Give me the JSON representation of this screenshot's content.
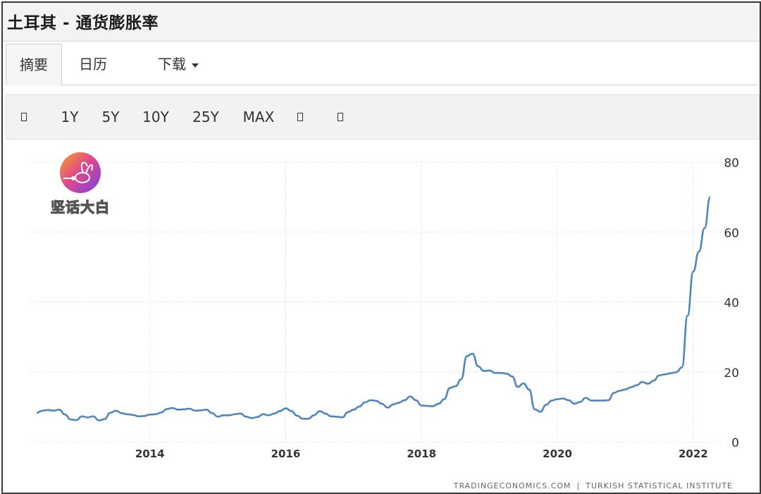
{
  "header": {
    "title": "土耳其 - 通货膨胀率"
  },
  "tabs": [
    {
      "label": "摘要"
    },
    {
      "label": "日历"
    },
    {
      "label": "下载"
    }
  ],
  "range_buttons": [
    "1Y",
    "5Y",
    "10Y",
    "25Y",
    "MAX"
  ],
  "range_icons": [
    "calendar-icon",
    "chart-type-icon",
    "settings-icon",
    "glyph-icon"
  ],
  "logo": {
    "text": "坚话大白"
  },
  "source": {
    "left": "TRADINGECONOMICS.COM",
    "separator": "|",
    "right": "TURKISH STATISTICAL INSTITUTE"
  },
  "colors": {
    "line": "#4f86bd",
    "grid": "#d8d8d8"
  },
  "chart_data": {
    "type": "line",
    "title": "",
    "xlabel": "",
    "ylabel": "",
    "x_ticks": [
      "2014",
      "2016",
      "2018",
      "2020",
      "2022"
    ],
    "y_ticks": [
      0,
      20,
      40,
      60,
      80
    ],
    "ylim": [
      0,
      80
    ],
    "xlim": [
      "2012-04",
      "2022-06"
    ],
    "y_axis_side": "right",
    "grid": true,
    "legend": "none",
    "series": [
      {
        "name": "",
        "points": [
          [
            "2012-05",
            8.3
          ],
          [
            "2012-06",
            8.9
          ],
          [
            "2012-07",
            9.1
          ],
          [
            "2012-08",
            8.9
          ],
          [
            "2012-09",
            9.2
          ],
          [
            "2012-10",
            7.8
          ],
          [
            "2012-11",
            6.4
          ],
          [
            "2012-12",
            6.2
          ],
          [
            "2013-01",
            7.3
          ],
          [
            "2013-02",
            7.0
          ],
          [
            "2013-03",
            7.3
          ],
          [
            "2013-04",
            6.1
          ],
          [
            "2013-05",
            6.5
          ],
          [
            "2013-06",
            8.3
          ],
          [
            "2013-07",
            8.9
          ],
          [
            "2013-08",
            8.2
          ],
          [
            "2013-09",
            7.9
          ],
          [
            "2013-10",
            7.7
          ],
          [
            "2013-11",
            7.3
          ],
          [
            "2013-12",
            7.4
          ],
          [
            "2014-01",
            7.8
          ],
          [
            "2014-02",
            7.9
          ],
          [
            "2014-03",
            8.4
          ],
          [
            "2014-04",
            9.4
          ],
          [
            "2014-05",
            9.7
          ],
          [
            "2014-06",
            9.2
          ],
          [
            "2014-07",
            9.3
          ],
          [
            "2014-08",
            9.5
          ],
          [
            "2014-09",
            8.9
          ],
          [
            "2014-10",
            9.0
          ],
          [
            "2014-11",
            9.2
          ],
          [
            "2014-12",
            8.2
          ],
          [
            "2015-01",
            7.2
          ],
          [
            "2015-02",
            7.6
          ],
          [
            "2015-03",
            7.6
          ],
          [
            "2015-04",
            7.9
          ],
          [
            "2015-05",
            8.1
          ],
          [
            "2015-06",
            7.2
          ],
          [
            "2015-07",
            6.8
          ],
          [
            "2015-08",
            7.1
          ],
          [
            "2015-09",
            7.9
          ],
          [
            "2015-10",
            7.6
          ],
          [
            "2015-11",
            8.1
          ],
          [
            "2015-12",
            8.8
          ],
          [
            "2016-01",
            9.6
          ],
          [
            "2016-02",
            8.8
          ],
          [
            "2016-03",
            7.5
          ],
          [
            "2016-04",
            6.6
          ],
          [
            "2016-05",
            6.6
          ],
          [
            "2016-06",
            7.6
          ],
          [
            "2016-07",
            8.8
          ],
          [
            "2016-08",
            8.1
          ],
          [
            "2016-09",
            7.3
          ],
          [
            "2016-10",
            7.2
          ],
          [
            "2016-11",
            7.0
          ],
          [
            "2016-12",
            8.5
          ],
          [
            "2017-01",
            9.2
          ],
          [
            "2017-02",
            10.1
          ],
          [
            "2017-03",
            11.3
          ],
          [
            "2017-04",
            11.9
          ],
          [
            "2017-05",
            11.7
          ],
          [
            "2017-06",
            10.9
          ],
          [
            "2017-07",
            9.8
          ],
          [
            "2017-08",
            10.7
          ],
          [
            "2017-09",
            11.2
          ],
          [
            "2017-10",
            11.9
          ],
          [
            "2017-11",
            13.0
          ],
          [
            "2017-12",
            11.9
          ],
          [
            "2018-01",
            10.4
          ],
          [
            "2018-02",
            10.3
          ],
          [
            "2018-03",
            10.2
          ],
          [
            "2018-04",
            10.9
          ],
          [
            "2018-05",
            12.2
          ],
          [
            "2018-06",
            15.4
          ],
          [
            "2018-07",
            15.9
          ],
          [
            "2018-08",
            17.9
          ],
          [
            "2018-09",
            24.5
          ],
          [
            "2018-10",
            25.2
          ],
          [
            "2018-11",
            21.6
          ],
          [
            "2018-12",
            20.3
          ],
          [
            "2019-01",
            20.4
          ],
          [
            "2019-02",
            19.7
          ],
          [
            "2019-03",
            19.7
          ],
          [
            "2019-04",
            19.5
          ],
          [
            "2019-05",
            18.7
          ],
          [
            "2019-06",
            15.7
          ],
          [
            "2019-07",
            16.7
          ],
          [
            "2019-08",
            15.0
          ],
          [
            "2019-09",
            9.3
          ],
          [
            "2019-10",
            8.6
          ],
          [
            "2019-11",
            10.6
          ],
          [
            "2019-12",
            11.8
          ],
          [
            "2020-01",
            12.2
          ],
          [
            "2020-02",
            12.4
          ],
          [
            "2020-03",
            11.9
          ],
          [
            "2020-04",
            10.9
          ],
          [
            "2020-05",
            11.4
          ],
          [
            "2020-06",
            12.6
          ],
          [
            "2020-07",
            11.8
          ],
          [
            "2020-08",
            11.8
          ],
          [
            "2020-09",
            11.8
          ],
          [
            "2020-10",
            11.9
          ],
          [
            "2020-11",
            14.0
          ],
          [
            "2020-12",
            14.6
          ],
          [
            "2021-01",
            15.0
          ],
          [
            "2021-02",
            15.6
          ],
          [
            "2021-03",
            16.2
          ],
          [
            "2021-04",
            17.1
          ],
          [
            "2021-05",
            16.6
          ],
          [
            "2021-06",
            17.5
          ],
          [
            "2021-07",
            19.0
          ],
          [
            "2021-08",
            19.3
          ],
          [
            "2021-09",
            19.6
          ],
          [
            "2021-10",
            19.9
          ],
          [
            "2021-11",
            21.3
          ],
          [
            "2021-12",
            36.1
          ],
          [
            "2022-01",
            48.7
          ],
          [
            "2022-02",
            54.4
          ],
          [
            "2022-03",
            61.1
          ],
          [
            "2022-04",
            70.0
          ]
        ]
      }
    ]
  }
}
